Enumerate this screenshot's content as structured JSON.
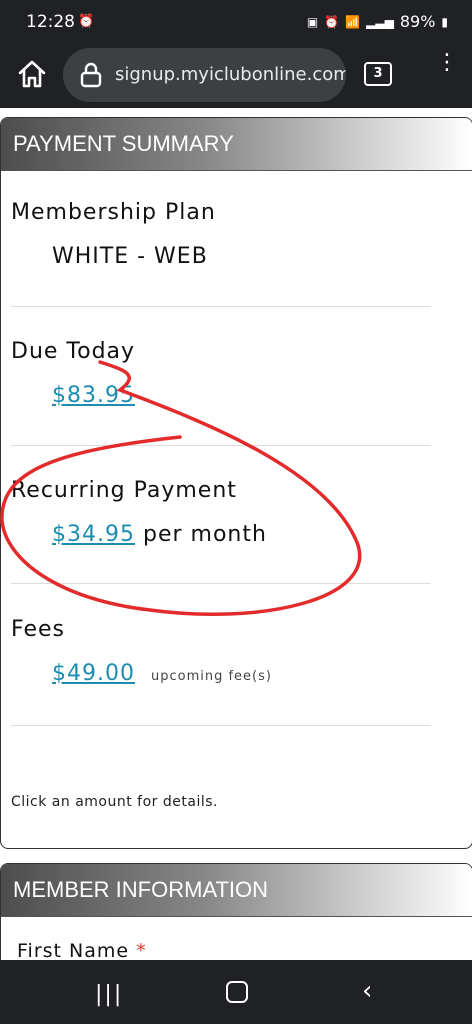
{
  "status_bar": {
    "time": "12:28",
    "battery": "89%",
    "signal_label": "6"
  },
  "browser": {
    "url": "signup.myiclubonline.com",
    "tab_count": "3"
  },
  "payment_summary": {
    "header": "PAYMENT SUMMARY",
    "membership_label": "Membership Plan",
    "membership_value": "WHITE - WEB",
    "due_today_label": "Due Today",
    "due_today_amount": "$83.95",
    "recurring_label": "Recurring Payment",
    "recurring_amount": "$34.95",
    "recurring_suffix": "per month",
    "fees_label": "Fees",
    "fees_amount": "$49.00",
    "fees_note": "upcoming fee(s)",
    "footer_note": "Click an amount for details."
  },
  "member_information": {
    "header": "MEMBER INFORMATION",
    "first_name_label": "First Name",
    "required_mark": "*"
  },
  "annotation_color": "#e32b2b"
}
